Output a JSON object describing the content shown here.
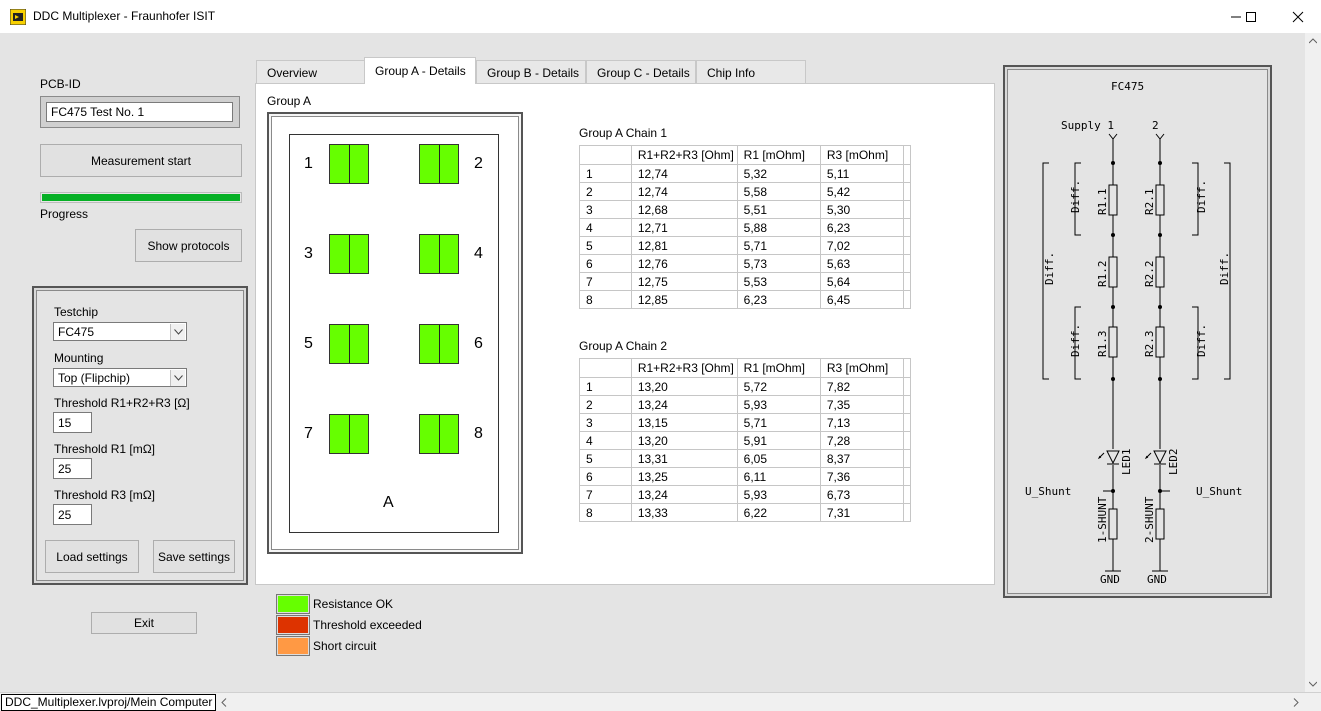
{
  "window": {
    "title": "DDC Multiplexer - Fraunhofer ISIT"
  },
  "left": {
    "pcb_id_label": "PCB-ID",
    "pcb_id_value": "FC475 Test No. 1",
    "measurement_start": "Measurement start",
    "progress_label": "Progress",
    "progress_fraction": 1.0,
    "show_protocols": "Show protocols",
    "testchip_label": "Testchip",
    "testchip_value": "FC475",
    "mounting_label": "Mounting",
    "mounting_value": "Top (Flipchip)",
    "threshold_total_label": "Threshold R1+R2+R3 [Ω]",
    "threshold_total_value": "15",
    "threshold_r1_label": "Threshold R1 [mΩ]",
    "threshold_r1_value": "25",
    "threshold_r3_label": "Threshold R3 [mΩ]",
    "threshold_r3_value": "25",
    "load_settings": "Load settings",
    "save_settings": "Save settings",
    "exit": "Exit"
  },
  "tabs": [
    "Overview",
    "Group A - Details",
    "Group B - Details",
    "Group C - Details",
    "Chip Info"
  ],
  "active_tab": 1,
  "group": {
    "title": "Group A",
    "chip_label": "A",
    "pads": [
      "1",
      "2",
      "3",
      "4",
      "5",
      "6",
      "7",
      "8"
    ],
    "pad_status_color": "#66ff00"
  },
  "chain1": {
    "title": "Group A Chain 1",
    "headers": [
      "",
      "R1+R2+R3 [Ohm]",
      "R1 [mOhm]",
      "R3 [mOhm]"
    ],
    "rows": [
      [
        "1",
        "12,74",
        "5,32",
        "5,11"
      ],
      [
        "2",
        "12,74",
        "5,58",
        "5,42"
      ],
      [
        "3",
        "12,68",
        "5,51",
        "5,30"
      ],
      [
        "4",
        "12,71",
        "5,88",
        "6,23"
      ],
      [
        "5",
        "12,81",
        "5,71",
        "7,02"
      ],
      [
        "6",
        "12,76",
        "5,73",
        "5,63"
      ],
      [
        "7",
        "12,75",
        "5,53",
        "5,64"
      ],
      [
        "8",
        "12,85",
        "6,23",
        "6,45"
      ]
    ]
  },
  "chain2": {
    "title": "Group A Chain 2",
    "headers": [
      "",
      "R1+R2+R3 [Ohm]",
      "R1 [mOhm]",
      "R3 [mOhm]"
    ],
    "rows": [
      [
        "1",
        "13,20",
        "5,72",
        "7,82"
      ],
      [
        "2",
        "13,24",
        "5,93",
        "7,35"
      ],
      [
        "3",
        "13,15",
        "5,71",
        "7,13"
      ],
      [
        "4",
        "13,20",
        "5,91",
        "7,28"
      ],
      [
        "5",
        "13,31",
        "6,05",
        "8,37"
      ],
      [
        "6",
        "13,25",
        "6,11",
        "7,36"
      ],
      [
        "7",
        "13,24",
        "5,93",
        "6,73"
      ],
      [
        "8",
        "13,33",
        "6,22",
        "7,31"
      ]
    ]
  },
  "legend": [
    {
      "label": "Resistance OK",
      "color": "#66ff00"
    },
    {
      "label": "Threshold exceeded",
      "color": "#dd3300"
    },
    {
      "label": "Short circuit",
      "color": "#ff9944"
    }
  ],
  "schematic": {
    "title": "FC475",
    "supply1": "Supply 1",
    "supply2": "2",
    "r11": "R1.1",
    "r12": "R1.2",
    "r13": "R1.3",
    "r21": "R2.1",
    "r22": "R2.2",
    "r23": "R2.3",
    "diff": "Diff.",
    "led1": "LED1",
    "led2": "LED2",
    "u_shunt": "U_Shunt",
    "shunt1": "1-SHUNT",
    "shunt2": "2-SHUNT",
    "gnd": "GND"
  },
  "status": {
    "path": "DDC_Multiplexer.lvproj/Mein Computer"
  },
  "colors": {
    "progress": "#06b025",
    "panel": "#e4e4e4"
  }
}
